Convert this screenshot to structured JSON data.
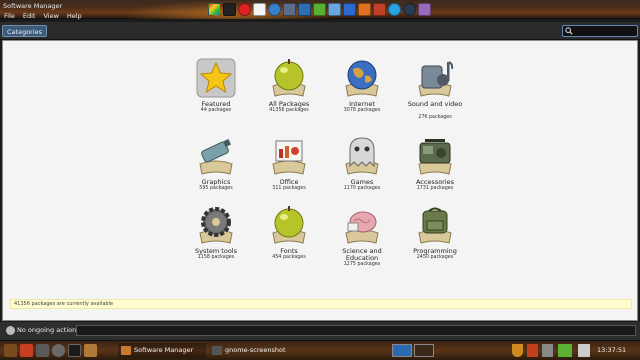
{
  "window": {
    "title": "Software Manager"
  },
  "menubar": [
    "File",
    "Edit",
    "View",
    "Help"
  ],
  "toolbar": {
    "categories_label": "Categories",
    "search_value": ""
  },
  "categories": [
    {
      "label": "Featured",
      "count": "44 packages"
    },
    {
      "label": "All Packages",
      "count": "41356 packages"
    },
    {
      "label": "Internet",
      "count": "3078 packages"
    },
    {
      "label": "Sound and video",
      "count": "276 packages"
    },
    {
      "label": "Graphics",
      "count": "595 packages"
    },
    {
      "label": "Office",
      "count": "311 packages"
    },
    {
      "label": "Games",
      "count": "1170 packages"
    },
    {
      "label": "Accessories",
      "count": "1731 packages"
    },
    {
      "label": "System tools",
      "count": "1158 packages"
    },
    {
      "label": "Fonts",
      "count": "454 packages"
    },
    {
      "label": "Science and Education",
      "count": "1275 packages"
    },
    {
      "label": "Programming",
      "count": "2450 packages"
    }
  ],
  "status": {
    "message": "41356 packages are currently available"
  },
  "actions": {
    "label": "No ongoing actions"
  },
  "taskbar": {
    "tasks": [
      {
        "label": "Software Manager"
      },
      {
        "label": "gnome-screenshot"
      }
    ],
    "clock": "13:37:51"
  },
  "colors": {
    "accent": "#5d8ab8",
    "status_bg": "#fffccf",
    "panel_brown": "#5a3518"
  }
}
